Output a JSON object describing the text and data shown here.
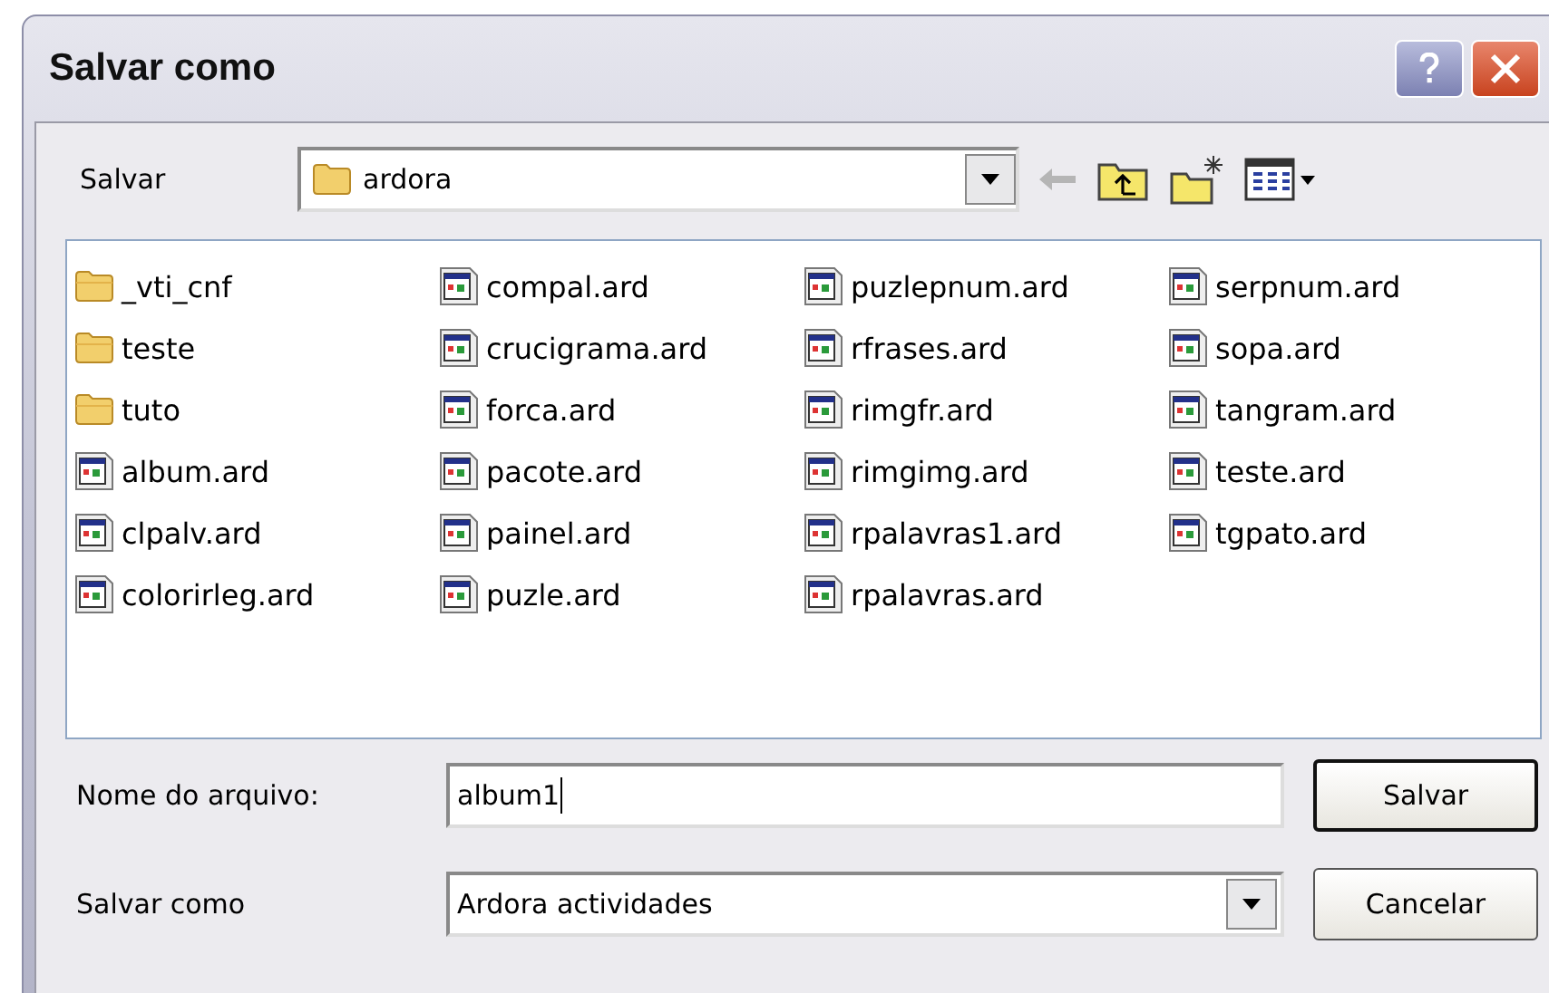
{
  "window": {
    "title": "Salvar como"
  },
  "location": {
    "label": "Salvar",
    "folder": "ardora"
  },
  "files": [
    {
      "name": "_vti_cnf",
      "kind": "folder"
    },
    {
      "name": "teste",
      "kind": "folder"
    },
    {
      "name": "tuto",
      "kind": "folder"
    },
    {
      "name": "album.ard",
      "kind": "file"
    },
    {
      "name": "clpalv.ard",
      "kind": "file"
    },
    {
      "name": "colorirleg.ard",
      "kind": "file"
    },
    {
      "name": "compal.ard",
      "kind": "file"
    },
    {
      "name": "crucigrama.ard",
      "kind": "file"
    },
    {
      "name": "forca.ard",
      "kind": "file"
    },
    {
      "name": "pacote.ard",
      "kind": "file"
    },
    {
      "name": "painel.ard",
      "kind": "file"
    },
    {
      "name": "puzle.ard",
      "kind": "file"
    },
    {
      "name": "puzlepnum.ard",
      "kind": "file"
    },
    {
      "name": "rfrases.ard",
      "kind": "file"
    },
    {
      "name": "rimgfr.ard",
      "kind": "file"
    },
    {
      "name": "rimgimg.ard",
      "kind": "file"
    },
    {
      "name": "rpalavras1.ard",
      "kind": "file"
    },
    {
      "name": "rpalavras.ard",
      "kind": "file"
    },
    {
      "name": "serpnum.ard",
      "kind": "file"
    },
    {
      "name": "sopa.ard",
      "kind": "file"
    },
    {
      "name": "tangram.ard",
      "kind": "file"
    },
    {
      "name": "teste.ard",
      "kind": "file"
    },
    {
      "name": "tgpato.ard",
      "kind": "file"
    }
  ],
  "filename": {
    "label": "Nome do arquivo:",
    "value": "album1"
  },
  "filetype": {
    "label": "Salvar como",
    "value": "Ardora actividades"
  },
  "buttons": [
    "Salvar",
    "Cancelar"
  ]
}
